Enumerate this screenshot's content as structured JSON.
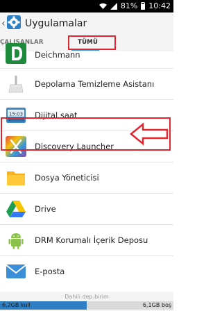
{
  "status_bar": {
    "battery_percent": "81%",
    "time": "10:42",
    "icons": [
      "wifi-icon",
      "signal-icon",
      "battery-icon"
    ]
  },
  "action_bar": {
    "title": "Uygulamalar",
    "icon": "settings-gear-icon"
  },
  "tabs": {
    "running": "ÇALIŞANLAR",
    "all": "TÜMÜ",
    "selected": "TÜMÜ"
  },
  "apps": [
    {
      "label": "Deichmann",
      "icon": "deichmann-icon"
    },
    {
      "label": "Depolama Temizleme Asistanı",
      "icon": "broom-icon"
    },
    {
      "label": "Dijital saat",
      "icon": "digital-clock-icon",
      "clock_text": "15:03"
    },
    {
      "label": "Discovery Launcher",
      "icon": "discovery-launcher-icon",
      "highlighted": true
    },
    {
      "label": "Dosya Yöneticisi",
      "icon": "folder-icon"
    },
    {
      "label": "Drive",
      "icon": "drive-icon"
    },
    {
      "label": "DRM Korumalı İçerik Deposu",
      "icon": "android-robot-icon"
    },
    {
      "label": "E-posta",
      "icon": "email-icon"
    }
  ],
  "storage": {
    "title": "Dahili dep.birim",
    "used": "6,2GB kull",
    "free": "6,1GB boş",
    "used_fraction": 0.5
  },
  "colors": {
    "highlight": "#e0262f",
    "tab_accent": "#2e9fd6",
    "storage_fill": "#2f7fc4"
  }
}
